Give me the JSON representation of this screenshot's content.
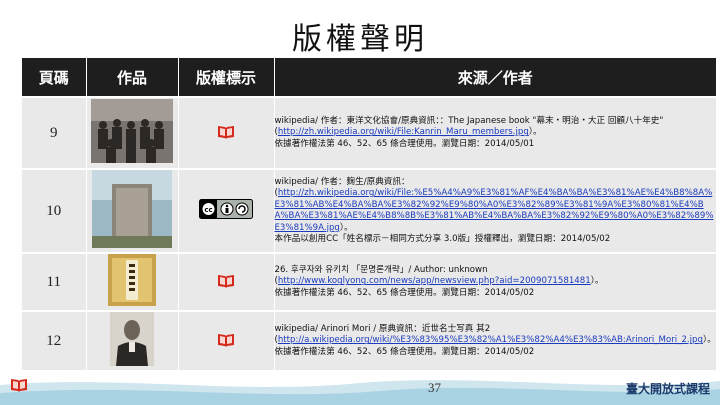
{
  "slide": {
    "title": "版權聲明",
    "page_number": "37",
    "footer_logo": "臺大開放式課程"
  },
  "table": {
    "headers": {
      "page": "頁碼",
      "work": "作品",
      "license": "版權標示",
      "source": "來源／作者"
    },
    "rows": [
      {
        "page": "9",
        "src": [
          "wikipedia/ 作者：東洋文化協會/原典資訊：：The Japanese book \"幕末・明治・大正 回顧八十年史\"",
          "http://zh.wikipedia.org/wiki/File:Kanrin_Maru_members.jpg",
          "）。",
          "依據著作權法第 46、52、65 條合理使用。瀏覽日期：2014/05/01"
        ]
      },
      {
        "page": "10",
        "src": [
          "wikipedia/ 作者：麴生/原典資訊：",
          "http://zh.wikipedia.org/wiki/File:%E5%A4%A9%E3%81%AF%E4%BA%BA%E3%81%AE%E4%B8%8A%E3%81%AB%E4%BA%BA%E3%82%92%E9%80%A0%E3%82%89%E3%81%9A%E3%80%81%E4%BA%BA%E3%81%AE%E4%B8%8B%E3%81%AB%E4%BA%BA%E3%82%92%E9%80%A0%E3%82%89%E3%81%9A.jpg",
          "）。",
          "本作品以創用CC「姓名標示－相同方式分享 3.0版」授權釋出，瀏覽日期：2014/05/02"
        ]
      },
      {
        "page": "11",
        "src": [
          "26. 후쿠자와 유키치 「문명론개략」/ Author: unknown",
          "http://www.koglyong.com/news/app/newsview.php?aid=2009071581481",
          "）。",
          "依據著作權法第 46、52、65 條合理使用。瀏覽日期：2014/05/02"
        ]
      },
      {
        "page": "12",
        "src": [
          "wikipedia/ Arinori Mori / 原典資訊：近世名士写真 其2",
          "http://a.wikipedia.org/wiki/%E3%83%95%E3%82%A1%E3%82%A4%E3%83%AB:Arinori_Mori_2.jpg",
          "）。",
          "依據著作權法第 46、52、65 條合理使用。瀏覽日期：2014/05/02"
        ]
      }
    ]
  },
  "colors": {
    "header_bg": "#1e1e1e",
    "row_bg": "#e9e9e9",
    "link": "#1a3bbd",
    "book_red": "#d42a1e"
  }
}
